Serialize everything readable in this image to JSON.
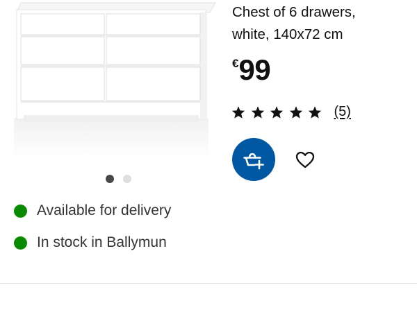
{
  "product": {
    "title_line1": "Chest of 6 drawers,",
    "title_line2": "white, 140x72 cm",
    "price": {
      "currency": "€",
      "amount": "99"
    },
    "rating": {
      "stars": 5,
      "max_stars": 5,
      "review_count": "(5)"
    },
    "image_name": "chest of drawers, white"
  },
  "carousel": {
    "total": 2,
    "active_index": 0
  },
  "availability": {
    "delivery": "Available for delivery",
    "stock": "In stock in Ballymun"
  },
  "actions": {
    "add_to_cart_icon": "shopping-basket-plus-icon",
    "favourite_icon": "heart-outline-icon"
  },
  "colors": {
    "accent_blue": "#0058a3",
    "status_green": "#0a8a00",
    "text_dark": "#111111",
    "dot_active": "#484848",
    "dot_inactive": "#dfdfdf"
  }
}
